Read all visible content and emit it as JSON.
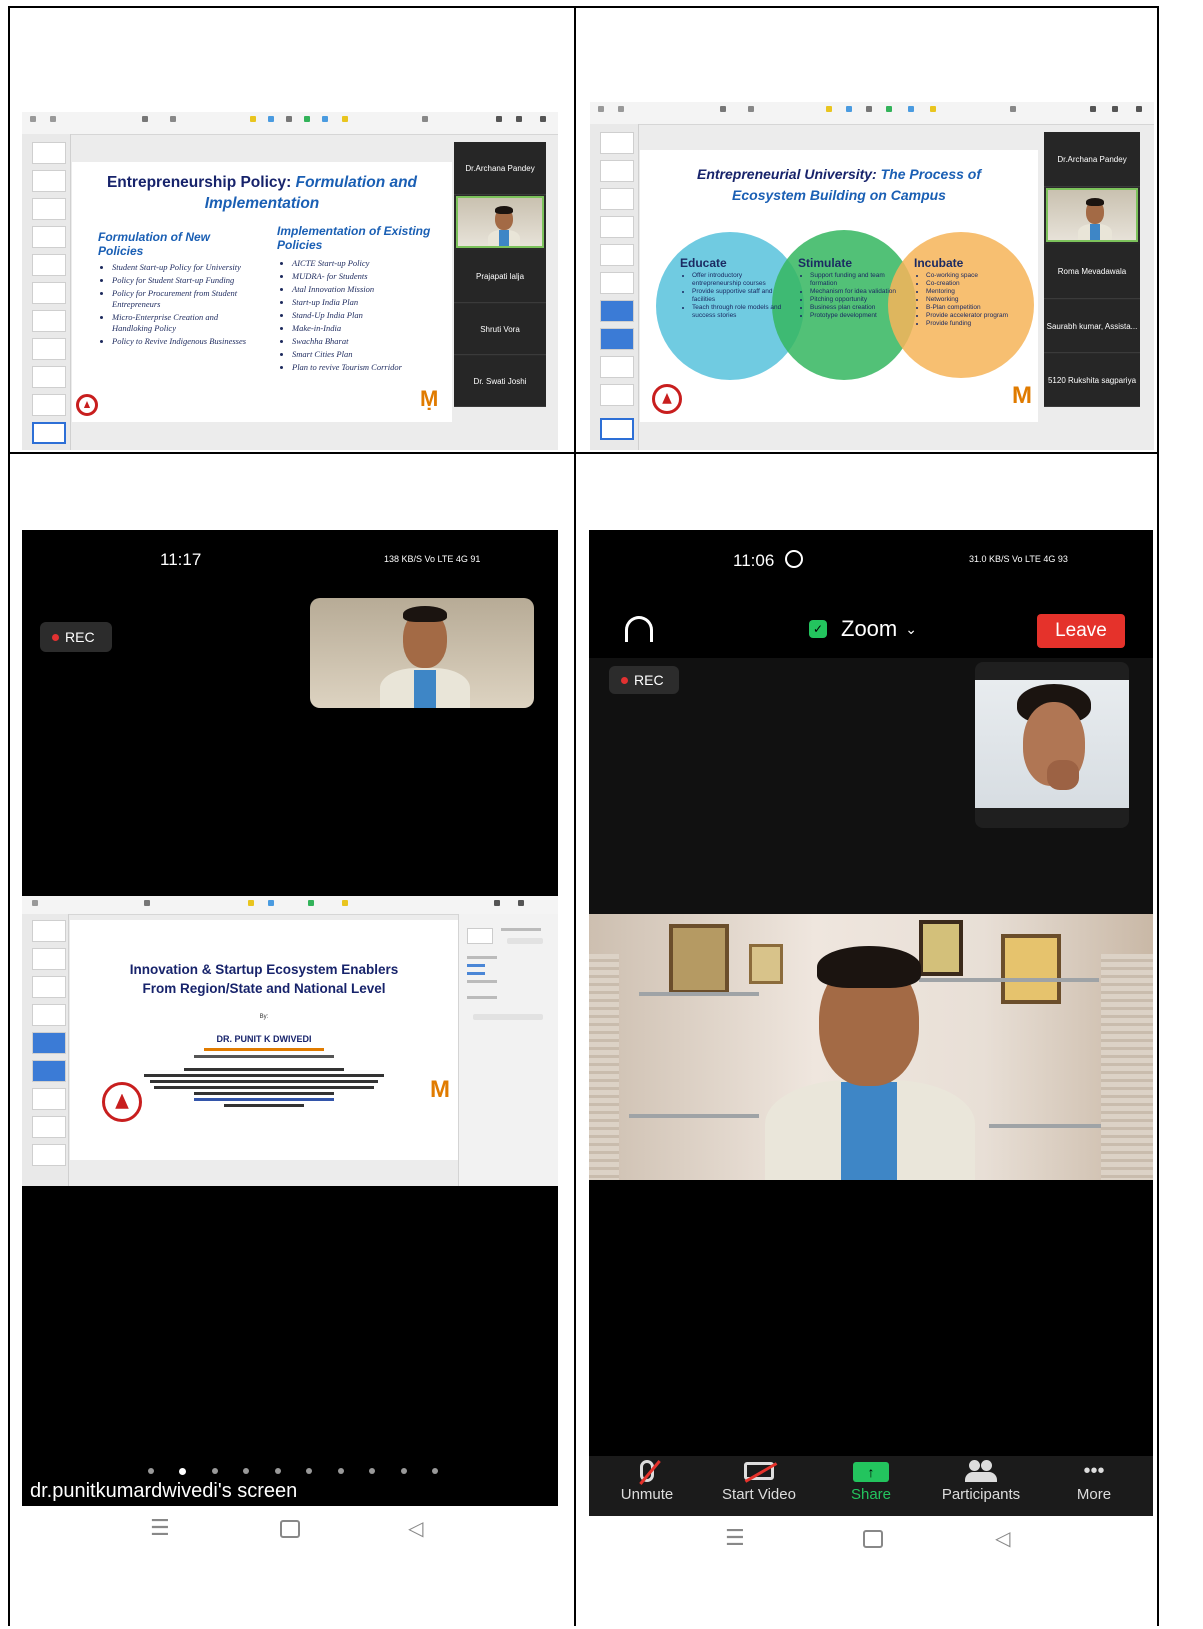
{
  "panel1": {
    "slide_title_a": "Entrepreneurship Policy: ",
    "slide_title_b": "Formulation and Implementation",
    "left_heading": "Formulation of New Policies",
    "left_items": [
      "Student Start-up Policy for University",
      "Policy for Student Start-up Funding",
      "Policy for Procurement from Student Entrepreneurs",
      "Micro-Enterprise Creation and Handloking Policy",
      "Policy to Revive Indigenous Businesses"
    ],
    "right_heading": "Implementation of Existing Policies",
    "right_items": [
      "AICTE Start-up Policy",
      "MUDRA- for Students",
      "Atal Innovation Mission",
      "Start-up India Plan",
      "Stand-Up India Plan",
      "Make-in-India",
      "Swachha Bharat",
      "Smart Cities Plan",
      "Plan to revive Tourism Corridor"
    ],
    "participants": [
      "Dr.Archana Pandey",
      "",
      "Prajapati lalja",
      "Shruti Vora",
      "Dr. Swati Joshi"
    ]
  },
  "panel2": {
    "slide_title_a": "Entrepreneurial University: ",
    "slide_title_b": "The Process of",
    "slide_title_c": "Ecosystem Building on Campus",
    "educate": {
      "title": "Educate",
      "items": [
        "Offer introductory entrepreneurship courses",
        "Provide supportive staff and facilities",
        "Teach through role models and success stories"
      ]
    },
    "stimulate": {
      "title": "Stimulate",
      "items": [
        "Support funding and team formation",
        "Mechanism for idea validation",
        "Pitching opportunity",
        "Business plan creation",
        "Prototype development"
      ]
    },
    "incubate": {
      "title": "Incubate",
      "items": [
        "Co-working space",
        "Co-creation",
        "Mentoring",
        "Networking",
        "B-Plan competition",
        "Provide accelerator program",
        "Provide funding"
      ]
    },
    "participants": [
      "Dr.Archana Pandey",
      "",
      "Roma Mevadawala",
      "Saurabh kumar, Assista...",
      "5120 Rukshita sagpariya"
    ]
  },
  "panel3": {
    "time": "11:17",
    "status_right": "138 KB/S  Vo LTE  4G  91",
    "rec": "REC",
    "slide_line1": "Innovation & Startup Ecosystem Enablers",
    "slide_line2": "From  Region/State and National Level",
    "by": "By:",
    "presenter": "DR. PUNIT K DWIVEDI",
    "footer_name": "dr.punitkumardwivedi's screen"
  },
  "panel4": {
    "time": "11:06",
    "status_right": "31.0 KB/S  Vo LTE  4G  93",
    "meeting": "Zoom",
    "leave": "Leave",
    "rec": "REC",
    "toolbar": [
      {
        "label": "Unmute",
        "icon": "mic-muted-icon"
      },
      {
        "label": "Start Video",
        "icon": "video-off-icon"
      },
      {
        "label": "Share",
        "icon": "share-icon"
      },
      {
        "label": "Participants",
        "icon": "participants-icon"
      },
      {
        "label": "More",
        "icon": "more-icon"
      }
    ],
    "accent_green": "#23c45e",
    "leave_red": "#e5322b"
  }
}
